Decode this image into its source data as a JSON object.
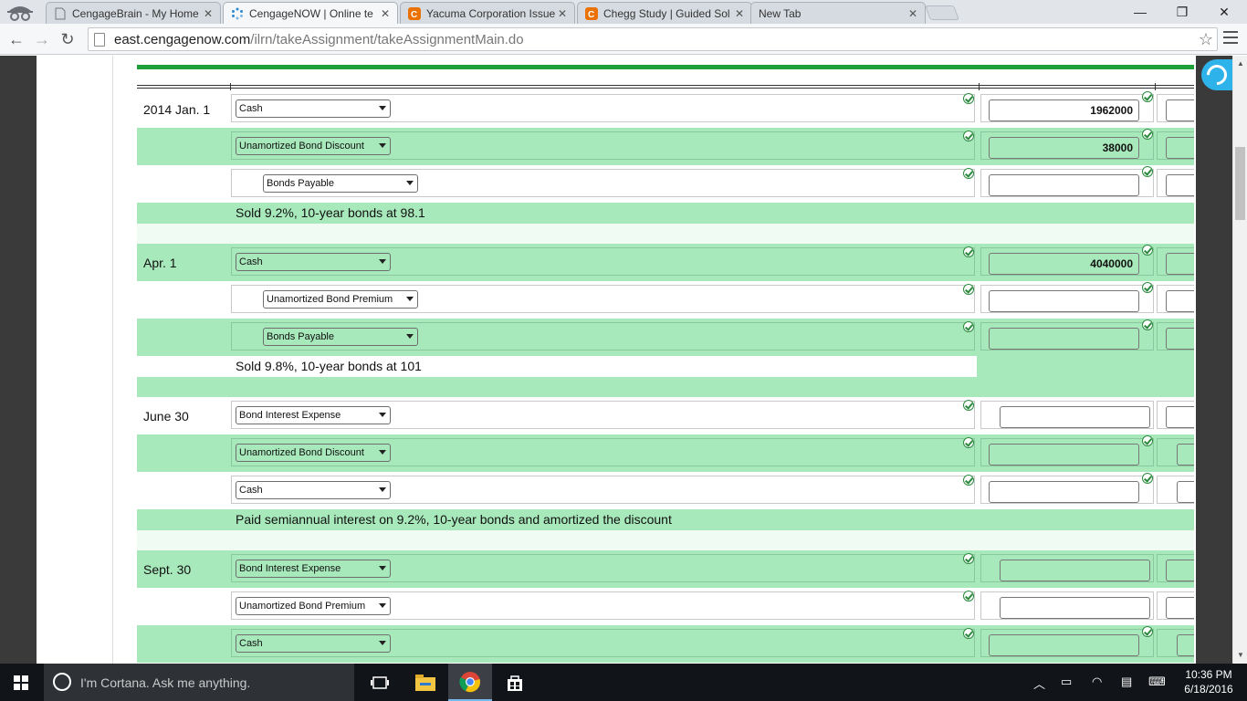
{
  "tabs": [
    {
      "title": "CengageBrain - My Home",
      "active": false
    },
    {
      "title": "CengageNOW | Online te",
      "active": true
    },
    {
      "title": "Yacuma Corporation Issue",
      "active": false
    },
    {
      "title": "Chegg Study | Guided Sol",
      "active": false
    },
    {
      "title": "New Tab",
      "active": false
    }
  ],
  "address": {
    "host": "east.cengagenow.com",
    "path": "/ilrn/takeAssignment/takeAssignmentMain.do"
  },
  "entries": [
    {
      "date": "2014 Jan. 1",
      "lines": [
        {
          "account": "Cash",
          "debit": "1962000",
          "credit": ""
        },
        {
          "account": "Unamortized Bond Discount",
          "debit": "38000",
          "credit": ""
        },
        {
          "account": "Bonds Payable",
          "debit": "",
          "credit": ""
        }
      ],
      "description": "Sold 9.2%, 10-year bonds at 98.1"
    },
    {
      "date": "Apr. 1",
      "lines": [
        {
          "account": "Cash",
          "debit": "4040000",
          "credit": ""
        },
        {
          "account": "Unamortized Bond Premium",
          "debit": "",
          "credit": ""
        },
        {
          "account": "Bonds Payable",
          "debit": "",
          "credit": ""
        }
      ],
      "description": "Sold 9.8%, 10-year bonds at 101"
    },
    {
      "date": "June 30",
      "lines": [
        {
          "account": "Bond Interest Expense",
          "debit": "",
          "credit": ""
        },
        {
          "account": "Unamortized Bond Discount",
          "debit": "",
          "credit": ""
        },
        {
          "account": "Cash",
          "debit": "",
          "credit": ""
        }
      ],
      "description": "Paid semiannual interest on 9.2%, 10-year bonds and amortized the discount"
    },
    {
      "date": "Sept. 30",
      "lines": [
        {
          "account": "Bond Interest Expense",
          "debit": "",
          "credit": ""
        },
        {
          "account": "Unamortized Bond Premium",
          "debit": "",
          "credit": ""
        },
        {
          "account": "Cash",
          "debit": "",
          "credit": ""
        }
      ]
    }
  ],
  "taskbar": {
    "cortana_placeholder": "I'm Cortana. Ask me anything.",
    "time": "10:36 PM",
    "date": "6/18/2016"
  }
}
